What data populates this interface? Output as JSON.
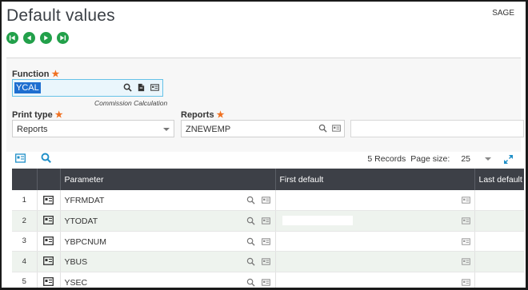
{
  "header": {
    "title": "Default values",
    "tenant": "SAGE"
  },
  "nav": {
    "first_icon": "first-record-icon",
    "prev_icon": "previous-record-icon",
    "next_icon": "next-record-icon",
    "last_icon": "last-record-icon",
    "color": "#22a04a"
  },
  "form": {
    "function_label": "Function",
    "function_value": "YCAL",
    "function_hint": "Commission Calculation",
    "print_type_label": "Print type",
    "print_type_value": "Reports",
    "reports_label": "Reports",
    "reports_value": "ZNEWEMP",
    "required_mark": "★"
  },
  "grid_toolbar": {
    "records": "5 Records",
    "page_size_label": "Page size:",
    "page_size_value": "25"
  },
  "table": {
    "columns": [
      "Parameter",
      "First default",
      "Last default"
    ],
    "rows": [
      {
        "num": "1",
        "param": "YFRMDAT"
      },
      {
        "num": "2",
        "param": "YTODAT"
      },
      {
        "num": "3",
        "param": "YBPCNUM"
      },
      {
        "num": "4",
        "param": "YBUS"
      },
      {
        "num": "5",
        "param": "YSEC"
      }
    ]
  },
  "colors": {
    "accent": "#1f8fc8",
    "header_bg": "#3d4047",
    "selection": "#1f6fd0",
    "required": "#f07020"
  }
}
